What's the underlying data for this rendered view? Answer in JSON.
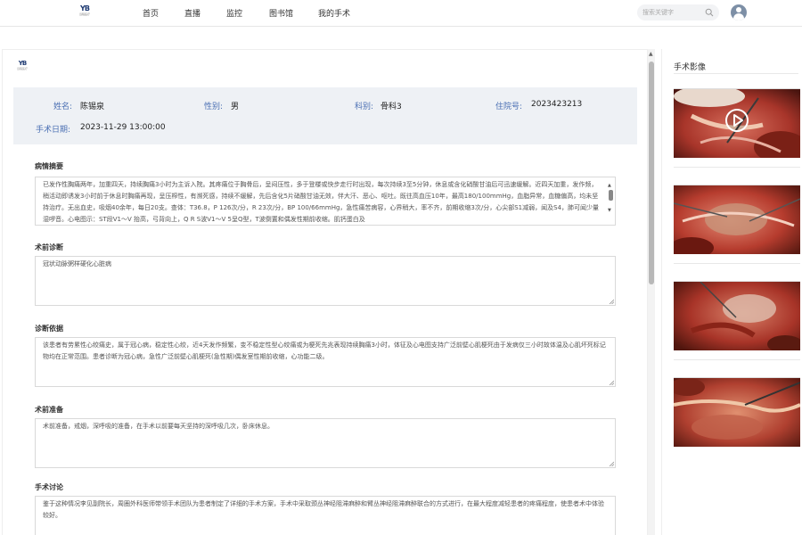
{
  "nav": {
    "logo_mark": "YB",
    "logo_sub": "远程医疗",
    "items": [
      "首页",
      "直播",
      "监控",
      "图书馆",
      "我的手术"
    ],
    "search_placeholder": "搜索关键字"
  },
  "patient": {
    "name_label": "姓名:",
    "name": "陈锡泉",
    "gender_label": "性别:",
    "gender": "男",
    "dept_label": "科别:",
    "dept": "骨科3",
    "admission_label": "住院号:",
    "admission": "2023423213",
    "date_label": "手术日期:",
    "date": "2023-11-29 13:00:00"
  },
  "sections": [
    {
      "title": "病情摘要",
      "text": "已发作性胸痛两年，加重四天，持续胸痛3小时为主诉入院。其疼痛位于胸骨后，呈闷压性，多于登楼或快步走行时出现，每次持续3至5分钟，休息或含化硝酸甘油后可迅速缓解。近四天加重，发作频，稍活动即诱发3小时前于休息时胸痛再现，呈压榨性，有濒死感，持续不缓解，先后含化5片硝酸甘油无效，伴大汗、恶心、呕吐。既往高血压10年，最高180/100mmHg，血脂异常，血糖偏高，均未坚持治疗。无出血史，吸烟40余年，每日20支。查体：T36.8，P 126次/分，R 23次/分，BP 100/66mmHg，急性痛苦病容，心界稍大，率不齐，前期收缩3次/分，心尖部S1减弱，闻及S4，肺可闻少量湿啰音。心电图示：ST段V1～V 抬高，弓背向上，Q R S波V1～V 5呈Q型，T波倒置和偶发性期前收缩。肌钙蛋白及"
    },
    {
      "title": "术前诊断",
      "text": "冠状动脉粥样硬化心脏病"
    },
    {
      "title": "诊断依据",
      "text": "该患者有劳累性心绞痛史，属于冠心病，稳定性心绞，近4天发作频繁，变不稳定性型心绞痛或为梗死先兆表现持续胸痛3小时，体征及心电图支持广泛前壁心肌梗死由于发病仅三小时故体温及心肌坏死标记物均在正常范围。患者诊断为冠心病，急性广泛前壁心肌梗死(急性期)偶发室性期前收缩，心功能二级。"
    },
    {
      "title": "术前准备",
      "text": "术前准备，戒烟，深呼吸的准备，在手术以前要每天坚持的深呼吸几次，卧床休息。"
    },
    {
      "title": "手术讨论",
      "text": "鉴于这种情况李见副院长，周圈外科医师带领手术团队为患者制定了详细的手术方案，手术中采取颈丛神经阻滞麻醉和臂丛神经阻滞麻醉联合的方式进行，在最大程度减轻患者的疼痛程度，使患者术中体验较好。"
    }
  ],
  "right_panel": {
    "title": "手术影像"
  },
  "colors": {
    "accent": "#4a6fb3",
    "info_bg": "#eef1f5"
  }
}
